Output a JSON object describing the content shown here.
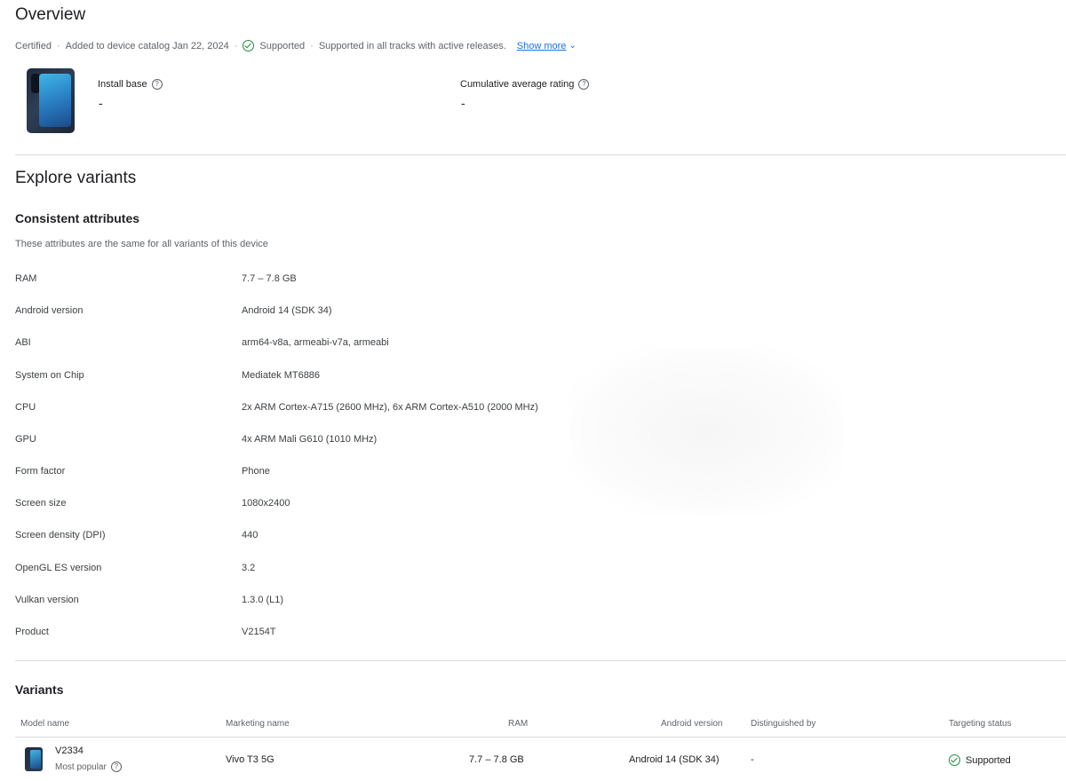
{
  "overview": {
    "title": "Overview",
    "meta": {
      "certified": "Certified",
      "added": "Added to device catalog Jan 22, 2024",
      "status": "Supported",
      "status_detail": "Supported in all tracks with active releases.",
      "show_more": "Show more"
    },
    "install_base": {
      "label": "Install base",
      "value": "-"
    },
    "rating": {
      "label": "Cumulative average rating",
      "value": "-"
    }
  },
  "explore": {
    "title": "Explore variants",
    "consistent": {
      "title": "Consistent attributes",
      "description": "These attributes are the same for all variants of this device",
      "attributes": [
        {
          "key": "RAM",
          "value": "7.7 – 7.8 GB"
        },
        {
          "key": "Android version",
          "value": "Android 14 (SDK 34)"
        },
        {
          "key": "ABI",
          "value": "arm64-v8a, armeabi-v7a, armeabi"
        },
        {
          "key": "System on Chip",
          "value": "Mediatek MT6886"
        },
        {
          "key": "CPU",
          "value": "2x ARM Cortex-A715 (2600 MHz), 6x ARM Cortex-A510 (2000 MHz)"
        },
        {
          "key": "GPU",
          "value": "4x ARM Mali G610 (1010 MHz)"
        },
        {
          "key": "Form factor",
          "value": "Phone"
        },
        {
          "key": "Screen size",
          "value": "1080x2400"
        },
        {
          "key": "Screen density (DPI)",
          "value": "440"
        },
        {
          "key": "OpenGL ES version",
          "value": "3.2"
        },
        {
          "key": "Vulkan version",
          "value": "1.3.0 (L1)"
        },
        {
          "key": "Product",
          "value": "V2154T"
        }
      ]
    }
  },
  "variants": {
    "title": "Variants",
    "columns": {
      "model_name": "Model name",
      "marketing_name": "Marketing name",
      "ram": "RAM",
      "android_version": "Android version",
      "distinguished_by": "Distinguished by",
      "targeting_status": "Targeting status"
    },
    "rows": [
      {
        "model_name": "V2334",
        "tag": "Most popular",
        "marketing_name": "Vivo T3 5G",
        "ram": "7.7 – 7.8 GB",
        "android_version": "Android 14 (SDK 34)",
        "distinguished_by": "-",
        "targeting_status": "Supported"
      }
    ]
  }
}
